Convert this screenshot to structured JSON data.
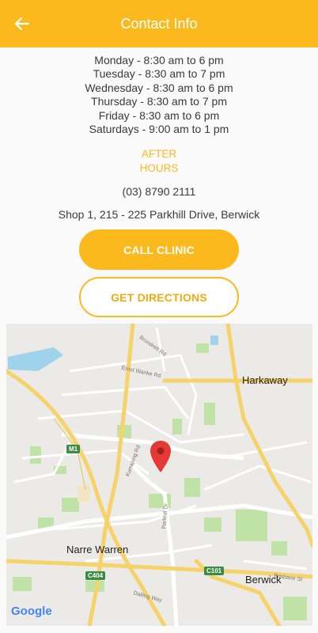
{
  "header": {
    "title": "Contact Info",
    "back_icon": "arrow-left-icon"
  },
  "hours": [
    "Monday - 8:30 am to 6 pm",
    "Tuesday - 8:30 am to 7 pm",
    "Wednesday - 8:30 am to 6 pm",
    "Thursday - 8:30 am to 7 pm",
    "Friday - 8:30 am to 6 pm",
    "Saturdays - 9:00 am to 1 pm"
  ],
  "after_hours": {
    "line1": "AFTER",
    "line2": "HOURS"
  },
  "phone": "(03) 8790 2111",
  "address": "Shop 1, 215 - 225 Parkhill Drive, Berwick",
  "buttons": {
    "call": "CALL CLINIC",
    "directions": "GET DIRECTIONS"
  },
  "map": {
    "places": {
      "harkaway": "Harkaway",
      "narre_warren": "Narre Warren",
      "berwick": "Berwick"
    },
    "roads": {
      "brundrett": "Brundrett Rd",
      "ernst_wanke": "Ernst Wanke Rd",
      "kurrajong": "Kurrajong Rd",
      "parkhill": "Parkhill Dr",
      "brisbane": "Brisbane St",
      "dalling": "Dalling Way"
    },
    "shields": {
      "m1": "M1",
      "c404": "C404",
      "c101": "C101"
    },
    "attribution": "Google",
    "colors": {
      "road_major": "#f5d36a",
      "park": "#bfe3a7",
      "water": "#9fd3ec",
      "pin": "#e53935"
    }
  },
  "colors": {
    "accent": "#fcb91d"
  }
}
